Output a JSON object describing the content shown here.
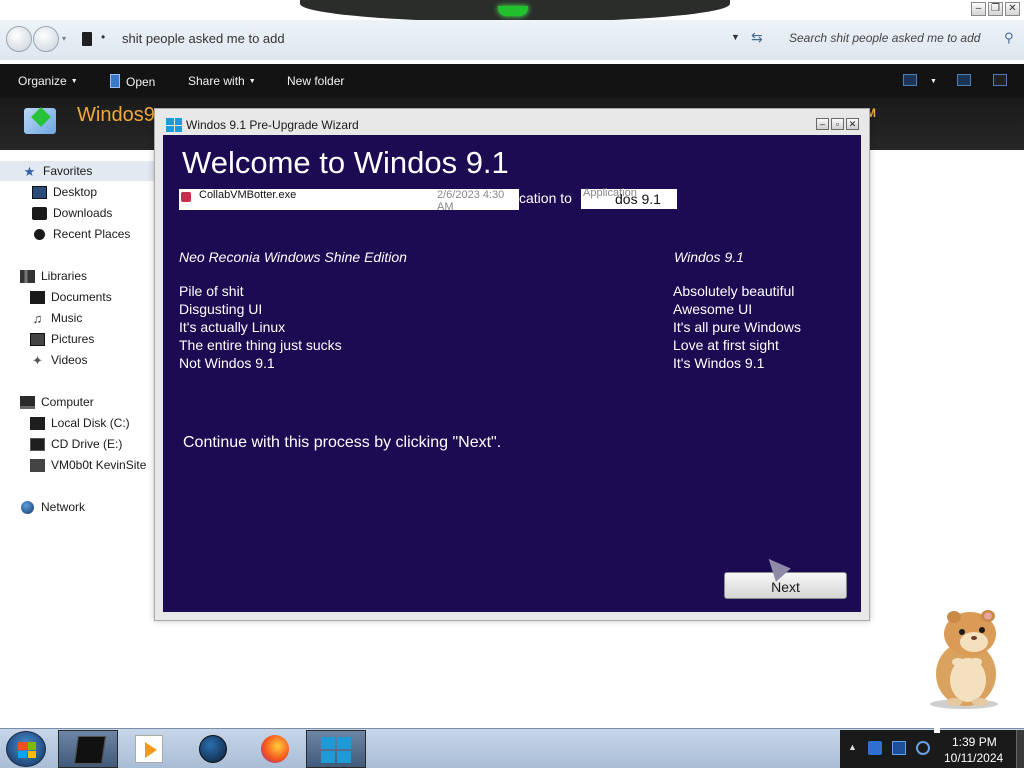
{
  "explorer": {
    "address_path": "shit people asked me to add",
    "search_placeholder": "Search shit people asked me to add",
    "header_title": "Windos9",
    "header_title_right": "M",
    "toolbar": {
      "organize": "Organize",
      "open": "Open",
      "share_with": "Share with",
      "new_folder": "New folder"
    },
    "nav": {
      "favorites": "Favorites",
      "desktop": "Desktop",
      "downloads": "Downloads",
      "recent_places": "Recent Places",
      "libraries": "Libraries",
      "documents": "Documents",
      "music": "Music",
      "pictures": "Pictures",
      "videos": "Videos",
      "computer": "Computer",
      "local_disk": "Local Disk (C:)",
      "cd_drive": "CD Drive (E:)",
      "network_drive": "VM0b0t KevinSite",
      "network": "Network"
    }
  },
  "wizard": {
    "window_title": "Windos 9.1 Pre-Upgrade Wizard",
    "heading": "Welcome to Windos 9.1",
    "overlay": {
      "file_name": "CollabVMBotter.exe",
      "file_date": "2/6/2023 4:30 AM",
      "file_type": "Application",
      "fragment_text": "cation  to",
      "fragment_text2": "dos 9.1"
    },
    "left_column": {
      "heading": "Neo Reconia Windows Shine Edition",
      "items": [
        "Pile of shit",
        "Disgusting UI",
        "It's actually Linux",
        "The entire thing just sucks",
        "Not Windos 9.1"
      ]
    },
    "right_column": {
      "heading": "Windos 9.1",
      "items": [
        "Absolutely beautiful",
        "Awesome UI",
        "It's all pure Windows",
        "Love at first sight",
        "It's Windos 9.1"
      ]
    },
    "continue_text": "Continue with this process by clicking \"Next\".",
    "next_button": "Next"
  },
  "taskbar": {
    "clock_time": "1:39 PM",
    "clock_date": "10/11/2024"
  }
}
